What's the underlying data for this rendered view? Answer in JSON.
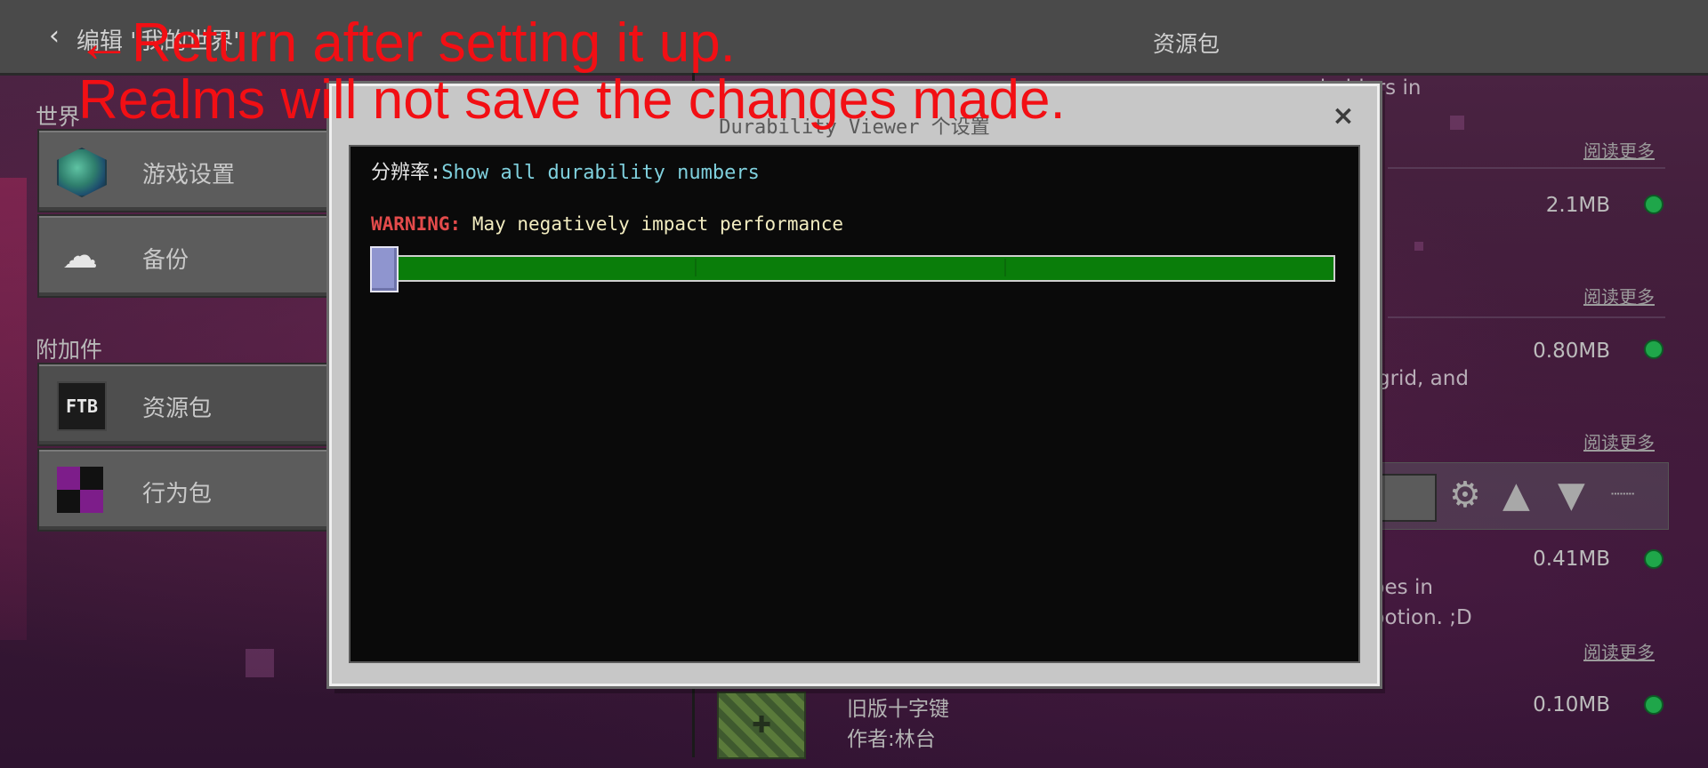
{
  "header": {
    "back_label": "编辑 \"我的世界\"",
    "title": "资源包"
  },
  "sidebar": {
    "world_section": "世界",
    "addons_section": "附加件",
    "items": [
      {
        "label": "游戏设置",
        "icon": "globe-icon"
      },
      {
        "label": "备份",
        "icon": "cloud-upload-icon"
      },
      {
        "label": "资源包",
        "icon": "ftb-pack-icon",
        "badge": "FTB"
      },
      {
        "label": "行为包",
        "icon": "checker-icon"
      }
    ]
  },
  "list": {
    "frag1": "...holders in",
    "frag2": "grid, and",
    "frag3": "...bes in",
    "frag4": "...potion. ;D",
    "sizes": [
      "2.1MB",
      "0.80MB",
      "0.41MB",
      "0.10MB"
    ],
    "read_more": "阅读更多",
    "last_item": {
      "name": "旧版十字键",
      "author": "作者:林台"
    }
  },
  "annotation": {
    "line1": "←Return after setting it up.",
    "line2": "Realms will not save the changes made."
  },
  "dialog": {
    "title": "Durability Viewer 个设置",
    "close": "×",
    "setting_label": "分辨率:",
    "setting_value": "Show all durability numbers",
    "warning_label": "WARNING:",
    "warning_text": "May negatively impact performance",
    "slider_level": 0
  },
  "colors": {
    "accent_green": "#0a7d0a",
    "status_green": "#1fa64a",
    "annotation_red": "#f20f14"
  }
}
